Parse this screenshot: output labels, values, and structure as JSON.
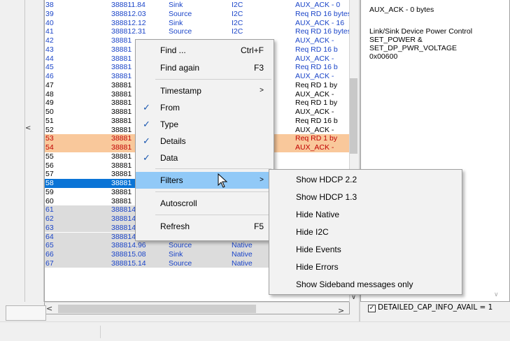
{
  "rows": [
    {
      "idx": "38",
      "ts": "388811.84",
      "src": "Sink",
      "typ": "I2C",
      "det": "AUX_ACK - 0",
      "bg": "#ffffff",
      "fg": "blue"
    },
    {
      "idx": "39",
      "ts": "388812.03",
      "src": "Source",
      "typ": "I2C",
      "det": "Req RD 16 bytes",
      "bg": "#ffffff",
      "fg": "blue"
    },
    {
      "idx": "40",
      "ts": "388812.12",
      "src": "Sink",
      "typ": "I2C",
      "det": "AUX_ACK - 16",
      "bg": "#ffffff",
      "fg": "blue"
    },
    {
      "idx": "41",
      "ts": "388812.31",
      "src": "Source",
      "typ": "I2C",
      "det": "Req RD 16 bytes",
      "bg": "#ffffff",
      "fg": "blue"
    },
    {
      "idx": "42",
      "ts": "38881",
      "src": "",
      "typ": "",
      "det": "AUX_ACK -",
      "bg": "#ffffff",
      "fg": "blue"
    },
    {
      "idx": "43",
      "ts": "38881",
      "src": "",
      "typ": "",
      "det": "Req RD 16 b",
      "bg": "#ffffff",
      "fg": "blue"
    },
    {
      "idx": "44",
      "ts": "38881",
      "src": "",
      "typ": "",
      "det": "AUX_ACK -",
      "bg": "#ffffff",
      "fg": "blue"
    },
    {
      "idx": "45",
      "ts": "38881",
      "src": "",
      "typ": "",
      "det": "Req RD 16 b",
      "bg": "#ffffff",
      "fg": "blue"
    },
    {
      "idx": "46",
      "ts": "38881",
      "src": "",
      "typ": "",
      "det": "AUX_ACK -",
      "bg": "#ffffff",
      "fg": "blue"
    },
    {
      "idx": "47",
      "ts": "38881",
      "src": "",
      "typ": "",
      "det": "Req RD 1 by",
      "bg": "#ffffff",
      "fg": "dark"
    },
    {
      "idx": "48",
      "ts": "38881",
      "src": "",
      "typ": "",
      "det": "AUX_ACK -",
      "bg": "#ffffff",
      "fg": "dark"
    },
    {
      "idx": "49",
      "ts": "38881",
      "src": "",
      "typ": "",
      "det": "Req RD 1 by",
      "bg": "#ffffff",
      "fg": "dark"
    },
    {
      "idx": "50",
      "ts": "38881",
      "src": "",
      "typ": "",
      "det": "AUX_ACK -",
      "bg": "#ffffff",
      "fg": "dark"
    },
    {
      "idx": "51",
      "ts": "38881",
      "src": "",
      "typ": "",
      "det": "Req RD 16 b",
      "bg": "#ffffff",
      "fg": "dark"
    },
    {
      "idx": "52",
      "ts": "38881",
      "src": "",
      "typ": "",
      "det": "AUX_ACK -",
      "bg": "#ffffff",
      "fg": "dark"
    },
    {
      "idx": "53",
      "ts": "38881",
      "src": "",
      "typ": "",
      "det": "Req RD 1 by",
      "bg": "#f9c89b",
      "fg": "red"
    },
    {
      "idx": "54",
      "ts": "38881",
      "src": "",
      "typ": "",
      "det": "AUX_ACK -",
      "bg": "#f9c89b",
      "fg": "red"
    },
    {
      "idx": "55",
      "ts": "38881",
      "src": "",
      "typ": "",
      "det": "",
      "bg": "#ffffff",
      "fg": "dark"
    },
    {
      "idx": "56",
      "ts": "38881",
      "src": "",
      "typ": "",
      "det": "",
      "bg": "#ffffff",
      "fg": "dark"
    },
    {
      "idx": "57",
      "ts": "38881",
      "src": "",
      "typ": "",
      "det": "",
      "bg": "#ffffff",
      "fg": "dark"
    },
    {
      "idx": "58",
      "ts": "38881",
      "src": "",
      "typ": "",
      "det": "",
      "bg": "#0a74d6",
      "fg": "sel"
    },
    {
      "idx": "59",
      "ts": "38881",
      "src": "",
      "typ": "",
      "det": "",
      "bg": "#ffffff",
      "fg": "dark"
    },
    {
      "idx": "60",
      "ts": "38881",
      "src": "",
      "typ": "",
      "det": "",
      "bg": "#ffffff",
      "fg": "dark"
    },
    {
      "idx": "61",
      "ts": "388814.58",
      "src": "Source",
      "typ": "Native",
      "det": "",
      "bg": "#dcdcdc",
      "fg": "blue"
    },
    {
      "idx": "62",
      "ts": "388814.71",
      "src": "Sink",
      "typ": "Native",
      "det": "",
      "bg": "#dcdcdc",
      "fg": "blue"
    },
    {
      "idx": "63",
      "ts": "388814.77",
      "src": "Source",
      "typ": "Native",
      "det": "",
      "bg": "#dcdcdc",
      "fg": "blue"
    },
    {
      "idx": "64",
      "ts": "388814.90",
      "src": "Sink",
      "typ": "Native",
      "det": "",
      "bg": "#dcdcdc",
      "fg": "blue"
    },
    {
      "idx": "65",
      "ts": "388814.96",
      "src": "Source",
      "typ": "Native",
      "det": "",
      "bg": "#dcdcdc",
      "fg": "blue"
    },
    {
      "idx": "66",
      "ts": "388815.08",
      "src": "Sink",
      "typ": "Native",
      "det": "",
      "bg": "#dcdcdc",
      "fg": "blue"
    },
    {
      "idx": "67",
      "ts": "388815.14",
      "src": "Source",
      "typ": "Native",
      "det": "Req WR 1 b",
      "bg": "#dcdcdc",
      "fg": "blue"
    }
  ],
  "left_pane": {
    "collapse_glyph": "<"
  },
  "scrollbars": {
    "left_arrow": "<",
    "right_arrow": ">",
    "down_arrow": "∨"
  },
  "right_pane": {
    "line1": "AUX_ACK - 0 bytes",
    "line2": "Link/Sink Device Power Control",
    "line3": "SET_POWER &",
    "line4": "SET_DP_PWR_VOLTAGE",
    "line5": "0x00600",
    "scroll_glyph": "∨",
    "cap_check_glyph": "✓",
    "cap_label": "DETAILED_CAP_INFO_AVAIL = 1"
  },
  "context_menu": {
    "find": "Find ...",
    "find_key": "Ctrl+F",
    "find_again": "Find again",
    "find_again_key": "F3",
    "timestamp": "Timestamp",
    "from": "From",
    "type": "Type",
    "details": "Details",
    "data": "Data",
    "filters": "Filters",
    "autoscroll": "Autoscroll",
    "refresh": "Refresh",
    "refresh_key": "F5",
    "check_glyph": "✓",
    "submenu_arrow": ">"
  },
  "filters_submenu": {
    "items": [
      "Show HDCP 2.2",
      "Show HDCP 1.3",
      "Hide Native",
      "Hide I2C",
      "Hide Events",
      "Hide Errors",
      "Show Sideband messages only"
    ]
  },
  "colors": {
    "selected_row": "#0a74d6",
    "error_row": "#f9c89b",
    "native_row": "#dcdcdc",
    "menu_highlight": "#91c9f7",
    "blue_text": "#1a44c8"
  }
}
